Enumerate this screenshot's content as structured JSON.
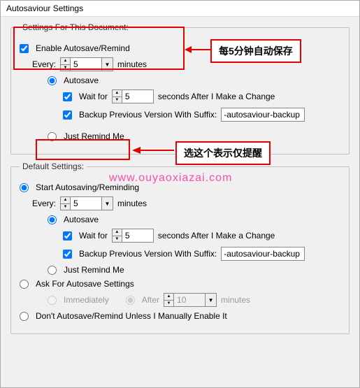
{
  "title": "Autosaviour Settings",
  "doc": {
    "legend": "Settings For This Document:",
    "enable": "Enable Autosave/Remind",
    "every": "Every:",
    "every_val": "5",
    "minutes": "minutes",
    "autosave": "Autosave",
    "waitfor": "Wait for",
    "waitfor_val": "5",
    "seconds": "seconds After I Make a Change",
    "backup": "Backup Previous Version With Suffix:",
    "backup_val": "-autosaviour-backup",
    "remind": "Just Remind Me"
  },
  "def": {
    "legend": "Default Settings:",
    "start": "Start Autosaving/Reminding",
    "every": "Every:",
    "every_val": "5",
    "minutes": "minutes",
    "autosave": "Autosave",
    "waitfor": "Wait for",
    "waitfor_val": "5",
    "seconds": "seconds After I Make a Change",
    "backup": "Backup Previous Version With Suffix:",
    "backup_val": "-autosaviour-backup",
    "remind": "Just Remind Me",
    "ask": "Ask For Autosave Settings",
    "immediately": "Immediately",
    "after": "After",
    "after_val": "10",
    "after_minutes": "minutes",
    "dont": "Don't Autosave/Remind Unless I Manually Enable It"
  },
  "annot": {
    "box1": "每5分钟自动保存",
    "box2": "选这个表示仅提醒"
  },
  "watermark": "www.ouyaoxiazai.com"
}
